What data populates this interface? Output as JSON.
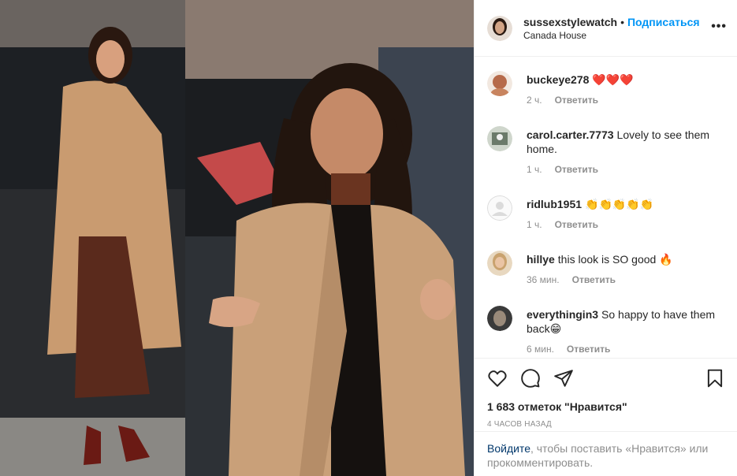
{
  "post": {
    "username": "sussexstylewatch",
    "separator": "•",
    "follow_label": "Подписаться",
    "location": "Canada House",
    "more_icon": "more-options-icon",
    "more_label": "•••"
  },
  "comments": [
    {
      "username": "buckeye278",
      "text": "❤️❤️❤️",
      "time": "2 ч.",
      "reply": "Ответить",
      "avatar_color": "#b66a4a"
    },
    {
      "username": "carol.carter.7773",
      "text": "Lovely to see them home.",
      "time": "1 ч.",
      "reply": "Ответить",
      "avatar_color": "#6b7a6a"
    },
    {
      "username": "ridlub1951",
      "text": "👏👏👏👏👏",
      "time": "1 ч.",
      "reply": "Ответить",
      "avatar_color": "#dbdbdb"
    },
    {
      "username": "hillye",
      "text": "this look is SO good 🔥",
      "time": "36 мин.",
      "reply": "Ответить",
      "avatar_color": "#c9a26e"
    },
    {
      "username": "everythingin3",
      "text": "So happy to have them back😁",
      "time": "6 мин.",
      "reply": "Ответить",
      "avatar_color": "#3a3a3a"
    }
  ],
  "actions": {
    "like_icon": "heart-icon",
    "comment_icon": "comment-icon",
    "share_icon": "share-icon",
    "save_icon": "bookmark-icon",
    "likes_text": "1 683 отметок \"Нравится\"",
    "time_ago": "4 часов назад"
  },
  "login_prompt": {
    "link": "Войдите",
    "rest": ", чтобы поставить «Нравится» или прокомментировать."
  },
  "colors": {
    "link_blue": "#0095f6",
    "muted": "#8e8e8e",
    "text": "#262626"
  }
}
